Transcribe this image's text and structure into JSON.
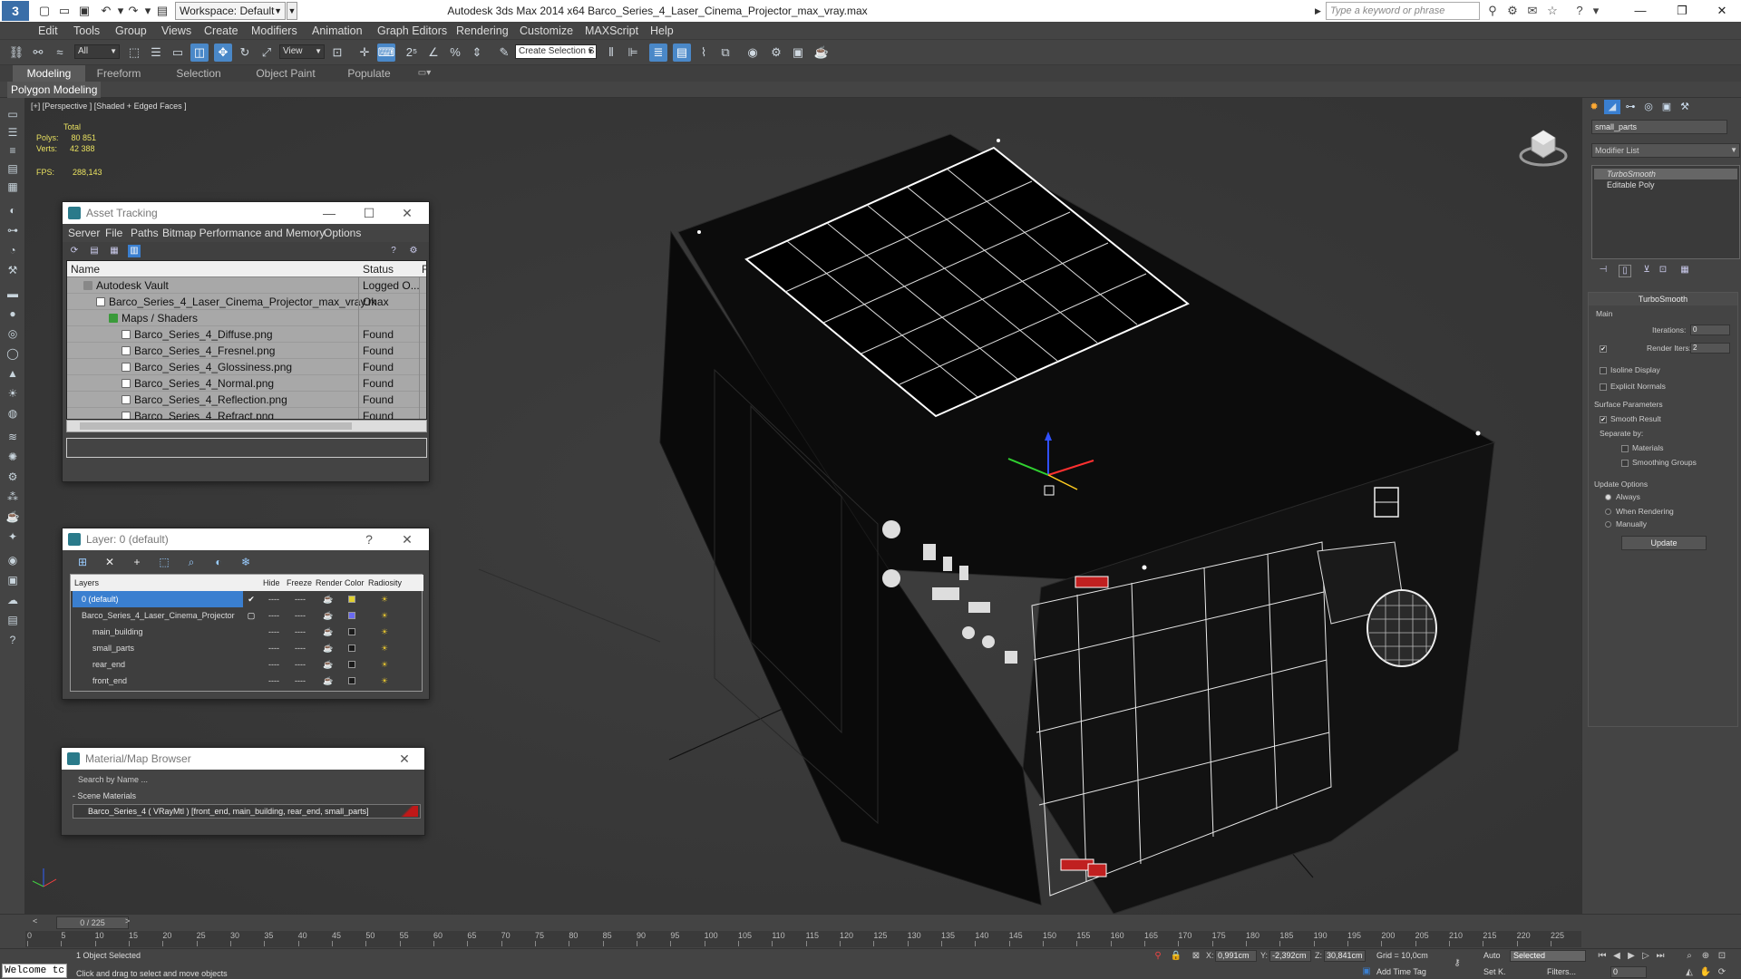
{
  "titlebar": {
    "app_icon": "3ds-max-logo",
    "workspace": "Workspace: Default",
    "title": "Autodesk 3ds Max  2014 x64     Barco_Series_4_Laser_Cinema_Projector_max_vray.max",
    "search_placeholder": "Type a keyword or phrase",
    "minimize": "—",
    "restore": "❐",
    "close": "✕"
  },
  "menu": [
    "Edit",
    "Tools",
    "Group",
    "Views",
    "Create",
    "Modifiers",
    "Animation",
    "Graph Editors",
    "Rendering",
    "Customize",
    "MAXScript",
    "Help"
  ],
  "toolbar": {
    "filter": "All",
    "ref_coord": "View",
    "selection_set": "Create Selection S"
  },
  "ribbon": {
    "tabs": [
      "Modeling",
      "Freeform",
      "Selection",
      "Object Paint",
      "Populate"
    ],
    "active_tab": "Modeling",
    "sub_label": "Polygon Modeling"
  },
  "viewport": {
    "label": "[+] [Perspective ] [Shaded + Edged Faces ]",
    "stats": {
      "total_label": "Total",
      "polys_label": "Polys:",
      "polys": "80 851",
      "verts_label": "Verts:",
      "verts": "42 388",
      "fps_label": "FPS:",
      "fps": "288,143"
    }
  },
  "asset_tracking": {
    "title": "Asset Tracking",
    "menu": [
      "Server",
      "File",
      "Paths",
      "Bitmap Performance and Memory",
      "Options"
    ],
    "columns": {
      "name": "Name",
      "status": "Status",
      "extra": "F"
    },
    "rows": [
      {
        "name": "Autodesk Vault",
        "status": "Logged O..."
      },
      {
        "name": "Barco_Series_4_Laser_Cinema_Projector_max_vray.max",
        "status": "Ok"
      },
      {
        "name": "Maps / Shaders",
        "status": ""
      },
      {
        "name": "Barco_Series_4_Diffuse.png",
        "status": "Found"
      },
      {
        "name": "Barco_Series_4_Fresnel.png",
        "status": "Found"
      },
      {
        "name": "Barco_Series_4_Glossiness.png",
        "status": "Found"
      },
      {
        "name": "Barco_Series_4_Normal.png",
        "status": "Found"
      },
      {
        "name": "Barco_Series_4_Reflection.png",
        "status": "Found"
      },
      {
        "name": "Barco_Series_4_Refract.png",
        "status": "Found"
      }
    ]
  },
  "layer_window": {
    "title": "Layer: 0 (default)",
    "help": "?",
    "columns": {
      "layers": "Layers",
      "hide": "Hide",
      "freeze": "Freeze",
      "render": "Render",
      "color": "Color",
      "radiosity": "Radiosity"
    },
    "rows": [
      {
        "name": "0 (default)",
        "color": "#e0d030"
      },
      {
        "name": "Barco_Series_4_Laser_Cinema_Projector",
        "color": "#6a6af0"
      },
      {
        "name": "main_building",
        "color": "#1a1a1a"
      },
      {
        "name": "small_parts",
        "color": "#1a1a1a"
      },
      {
        "name": "rear_end",
        "color": "#1a1a1a"
      },
      {
        "name": "front_end",
        "color": "#1a1a1a"
      }
    ],
    "dashes": "----"
  },
  "material_browser": {
    "title": "Material/Map Browser",
    "search_placeholder": "Search by Name ...",
    "section": "- Scene Materials",
    "item": "Barco_Series_4  ( VRayMtl ) [front_end, main_building, rear_end, small_parts]"
  },
  "command_panel": {
    "object_name": "small_parts",
    "modifier_list": "Modifier List",
    "stack": [
      "TurboSmooth",
      "Editable Poly"
    ],
    "turbosmooth": {
      "title": "TurboSmooth",
      "main": "Main",
      "iterations_label": "Iterations:",
      "iterations": "0",
      "render_iters_label": "Render Iters:",
      "render_iters": "2",
      "isoline": "Isoline Display",
      "explicit": "Explicit Normals",
      "surface_params": "Surface Parameters",
      "smooth_result": "Smooth Result",
      "separate_by": "Separate by:",
      "materials": "Materials",
      "smoothing_groups": "Smoothing Groups",
      "update_options": "Update Options",
      "always": "Always",
      "when_rendering": "When Rendering",
      "manually": "Manually",
      "update": "Update"
    }
  },
  "timeline": {
    "frame": "0 / 225",
    "ticks": [
      "0",
      "5",
      "10",
      "15",
      "20",
      "25",
      "30",
      "35",
      "40",
      "45",
      "50",
      "55",
      "60",
      "65",
      "70",
      "75",
      "80",
      "85",
      "90",
      "95",
      "100",
      "105",
      "110",
      "115",
      "120",
      "125",
      "130",
      "135",
      "140",
      "145",
      "150",
      "155",
      "160",
      "165",
      "170",
      "175",
      "180",
      "185",
      "190",
      "195",
      "200",
      "205",
      "210",
      "215",
      "220",
      "225"
    ]
  },
  "statusbar": {
    "maxscript": "Welcome tc",
    "selected": "1 Object Selected",
    "prompt": "Click and drag to select and move objects",
    "x_label": "X:",
    "x": "0,991cm",
    "y_label": "Y:",
    "y": "-2,392cm",
    "z_label": "Z:",
    "z": "30,841cm",
    "grid": "Grid = 10,0cm",
    "add_time_tag": "Add Time Tag",
    "auto": "Auto",
    "set_k": "Set K.",
    "selected_dd": "Selected",
    "filters": "Filters...",
    "frame_field": "0"
  }
}
